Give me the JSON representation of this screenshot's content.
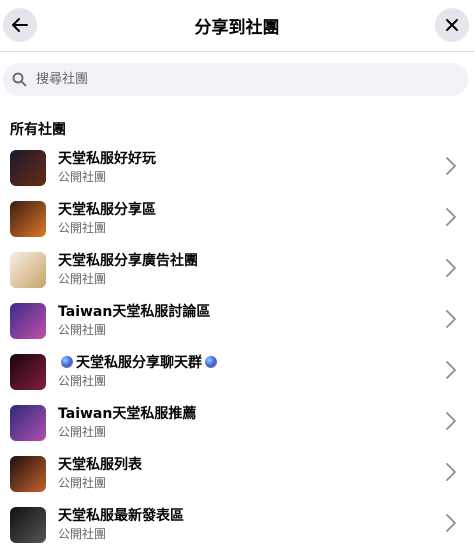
{
  "header": {
    "title": "分享到社團"
  },
  "search": {
    "placeholder": "搜尋社團"
  },
  "section": {
    "title": "所有社團"
  },
  "groups": [
    {
      "name": "天堂私服好好玩",
      "privacy": "公開社團",
      "thumb": [
        "#1a1a2e",
        "#6b2a14"
      ]
    },
    {
      "name": "天堂私服分享區",
      "privacy": "公開社團",
      "thumb": [
        "#3a1c10",
        "#e0782a"
      ]
    },
    {
      "name": "天堂私服分享廣告社團",
      "privacy": "公開社團",
      "thumb": [
        "#f7efe3",
        "#c9a26b"
      ]
    },
    {
      "name": "Taiwan天堂私服討論區",
      "privacy": "公開社團",
      "thumb": [
        "#3a2b8a",
        "#c34fa8"
      ]
    },
    {
      "name": "天堂私服分享聊天群",
      "privacy": "公開社團",
      "thumb": [
        "#14060e",
        "#8a1c3e"
      ]
    },
    {
      "name": "Taiwan天堂私服推薦",
      "privacy": "公開社團",
      "thumb": [
        "#2c2a7a",
        "#b14fb0"
      ]
    },
    {
      "name": "天堂私服列表",
      "privacy": "公開社團",
      "thumb": [
        "#1a1010",
        "#c8612a"
      ]
    },
    {
      "name": "天堂私服最新發表區",
      "privacy": "公開社團",
      "thumb": [
        "#101010",
        "#555555"
      ]
    }
  ],
  "icons": {
    "back": "arrow-left-icon",
    "close": "close-icon",
    "search": "search-icon",
    "chevron": "chevron-right-icon",
    "gem": "gem-emoji-icon"
  }
}
